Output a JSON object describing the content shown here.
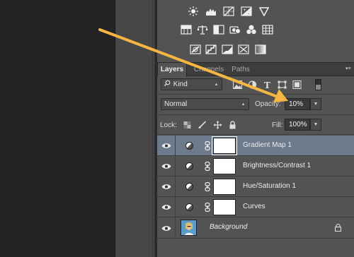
{
  "layers_panel": {
    "tabs": [
      {
        "label": "Layers",
        "active": true
      },
      {
        "label": "Channels",
        "active": false
      },
      {
        "label": "Paths",
        "active": false
      }
    ],
    "filter": {
      "value": "Kind"
    },
    "blend_mode": {
      "value": "Normal"
    },
    "opacity": {
      "label": "Opacity:",
      "value": "10%"
    },
    "lock": {
      "label": "Lock:"
    },
    "fill": {
      "label": "Fill:",
      "value": "100%"
    },
    "layers": [
      {
        "name": "Gradient Map 1",
        "selected": true
      },
      {
        "name": "Brightness/Contrast 1",
        "selected": false
      },
      {
        "name": "Hue/Saturation 1",
        "selected": false
      },
      {
        "name": "Curves",
        "selected": false
      },
      {
        "name": "Background",
        "selected": false,
        "locked": true
      }
    ]
  },
  "annotation": {
    "arrow_color": "#f5b642"
  },
  "colors": {
    "panel": "#535353",
    "selected_row": "#6d7a8c",
    "canvas": "#232323"
  }
}
